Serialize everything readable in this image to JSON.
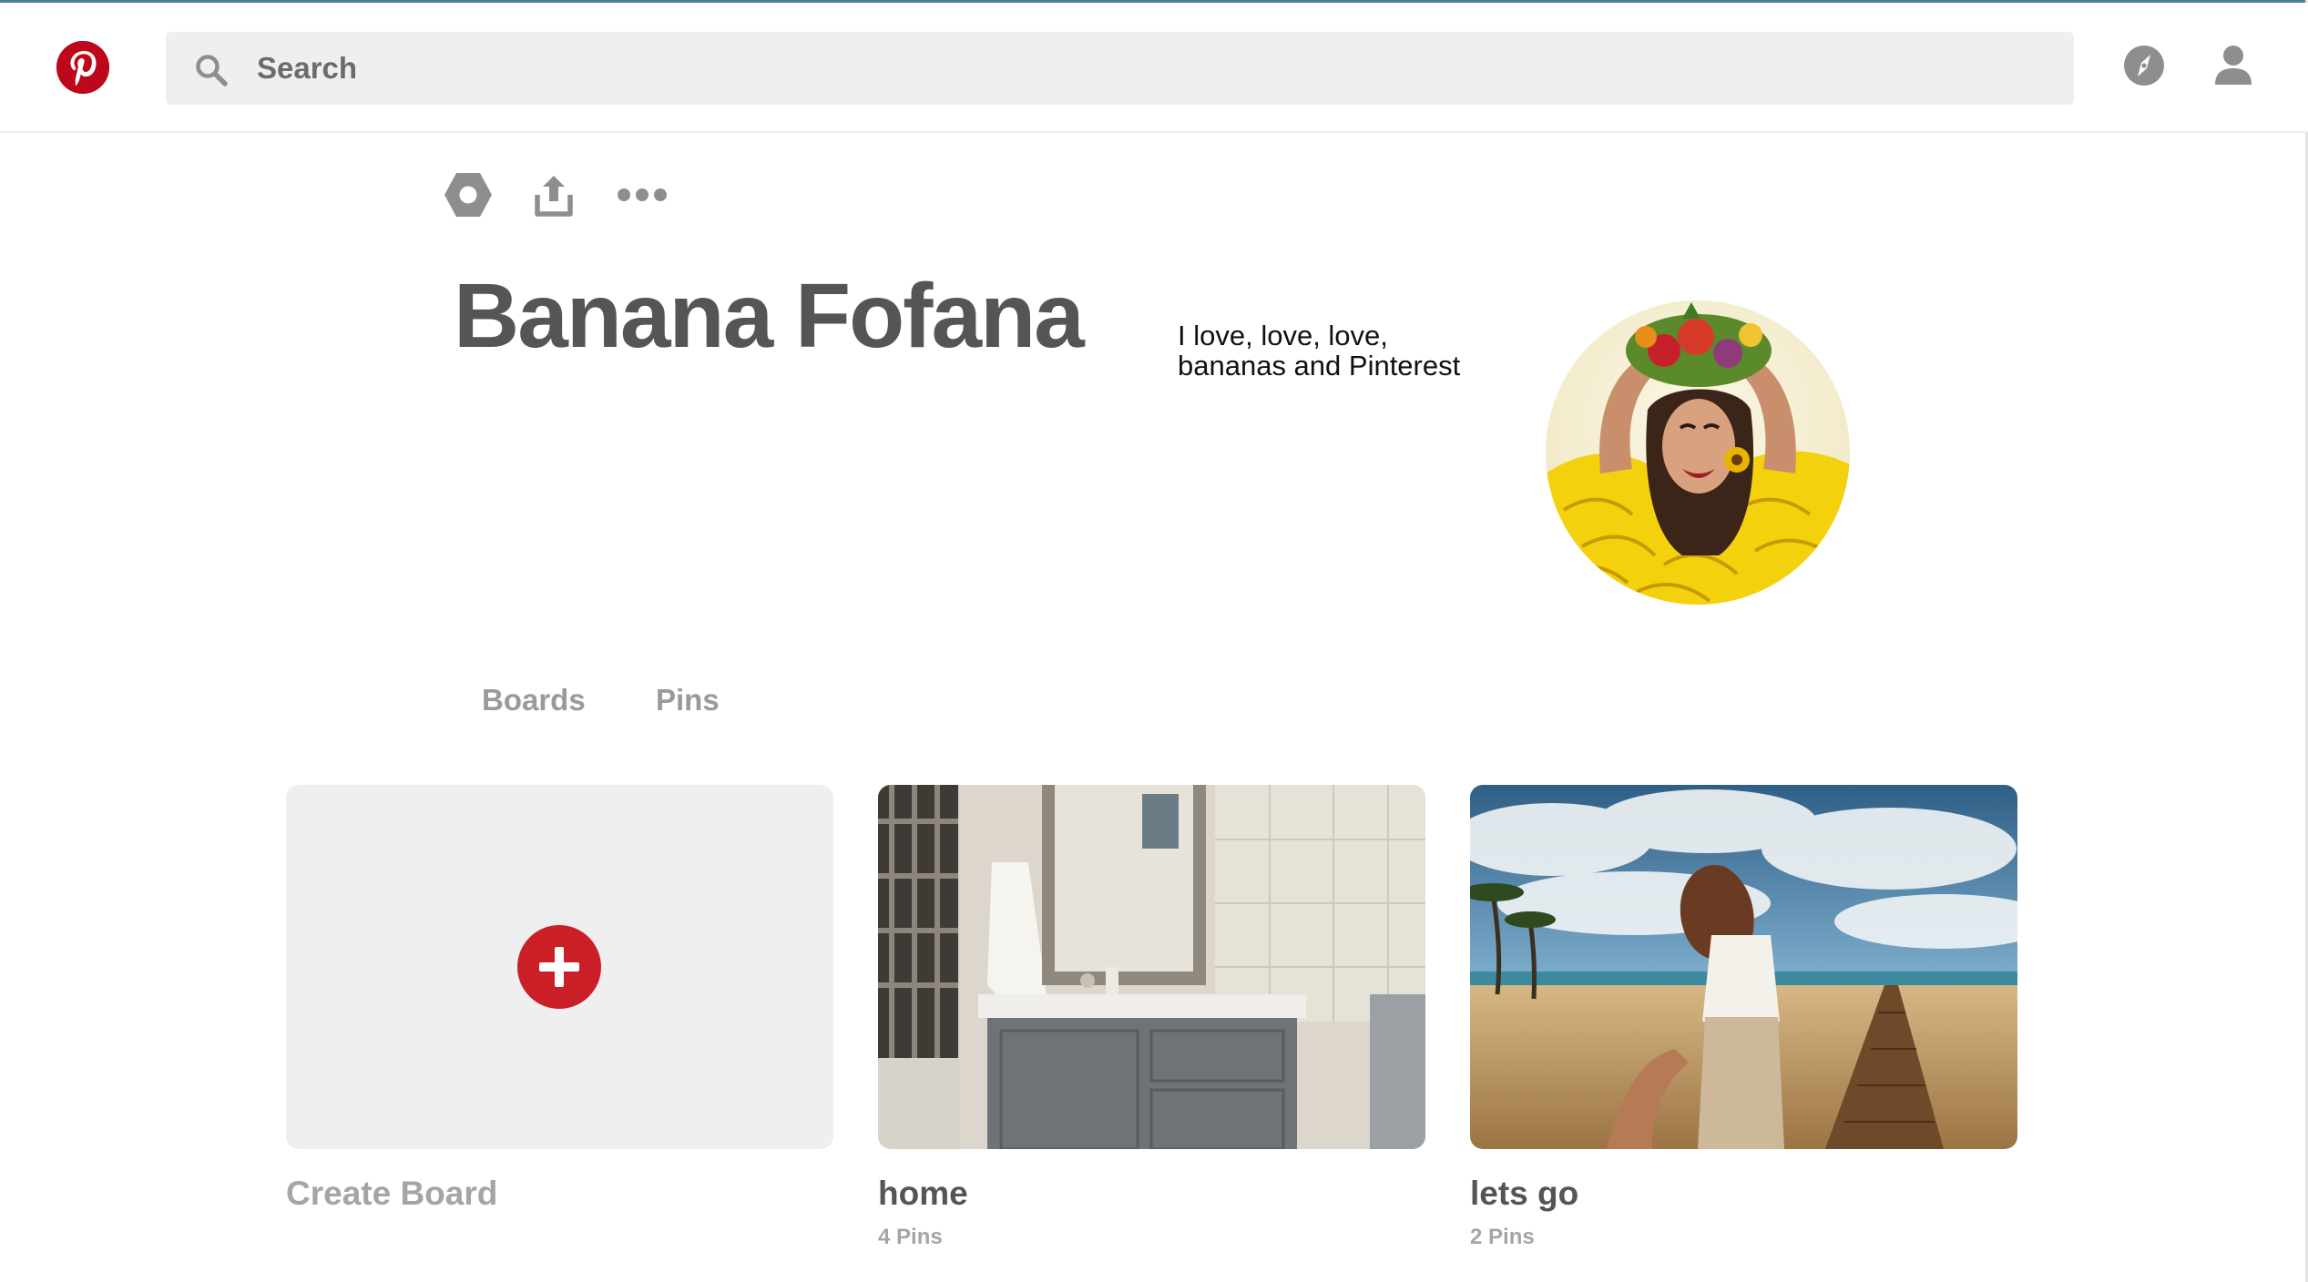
{
  "header": {
    "search_placeholder": "Search"
  },
  "profile": {
    "name": "Banana Fofana",
    "bio_lines": [
      "I love, love, love,",
      "bananas and Pinterest"
    ]
  },
  "tabs": [
    {
      "label": "Boards"
    },
    {
      "label": "Pins"
    }
  ],
  "boards": [
    {
      "title": "Create Board"
    },
    {
      "title": "home",
      "pins": "4 Pins"
    },
    {
      "title": "lets go",
      "pins": "2 Pins"
    }
  ],
  "icons": {
    "logo": "pinterest-logo",
    "search": "search-icon",
    "explore": "compass-icon",
    "profile": "user-icon",
    "settings": "hexagon-settings-icon",
    "share": "share-icon",
    "more": "more-dots-icon",
    "add": "plus-icon"
  },
  "colors": {
    "brand": "#bd081c",
    "create_plus": "#cb1f27",
    "text_dark": "#555555",
    "text_muted": "#a5a5a5"
  }
}
